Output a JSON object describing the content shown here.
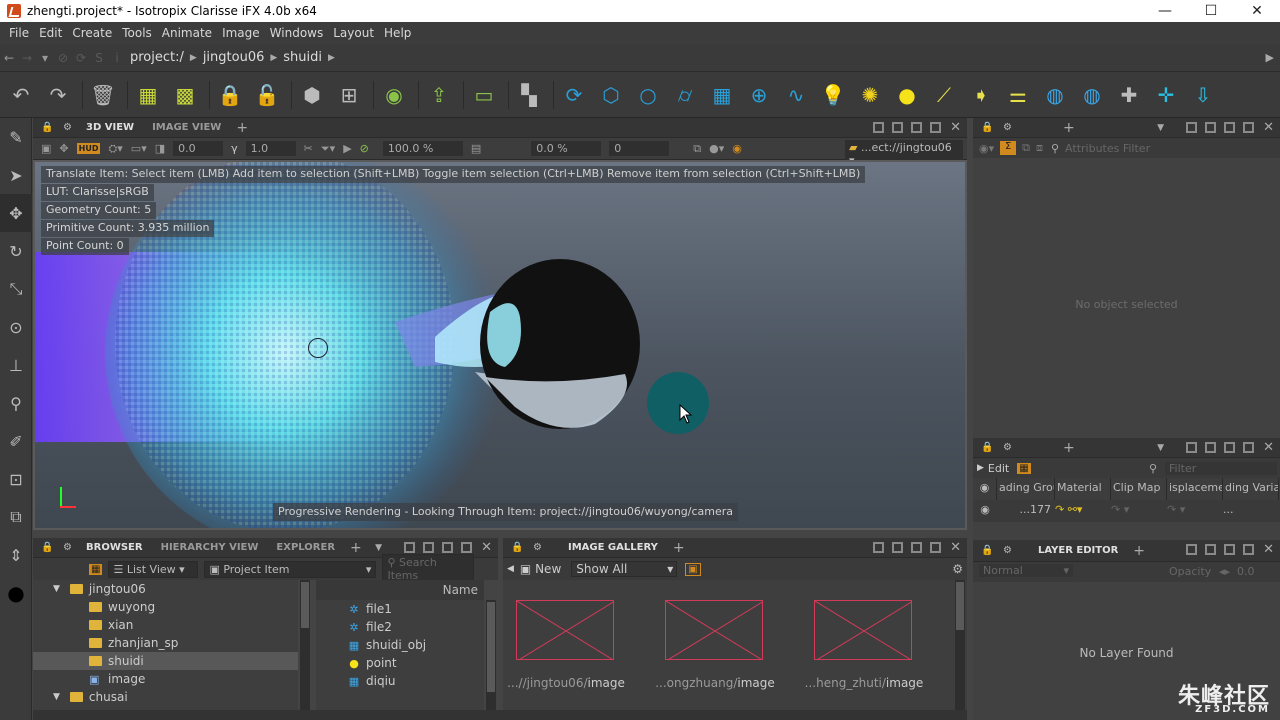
{
  "window": {
    "title": "zhengti.project* - Isotropix Clarisse iFX 4.0b x64"
  },
  "menu": [
    "File",
    "Edit",
    "Create",
    "Tools",
    "Animate",
    "Image",
    "Windows",
    "Layout",
    "Help"
  ],
  "pathbar": {
    "segments": [
      "project:/",
      "jingtou06",
      "shuidi"
    ]
  },
  "toolbar_icons": [
    "undo-icon",
    "redo-icon",
    "delete-icon",
    "group-icon",
    "ungroup-icon",
    "lock-icon",
    "unlock-icon",
    "box-icon",
    "scatter-icon",
    "reference-icon",
    "import-icon",
    "comment-icon",
    "context-icon",
    "rotate-icon",
    "cube-icon",
    "sphere-icon",
    "cylinder-icon",
    "grid-icon",
    "geosphere-icon",
    "curve-icon",
    "light-bulb-icon",
    "sun-icon",
    "point-light-icon",
    "spotlight-icon",
    "directional-light-icon",
    "area-light-icon",
    "sky-icon",
    "globe-icon",
    "transform-icon",
    "add-icon",
    "download-icon"
  ],
  "viewport": {
    "tabs": [
      "3D VIEW",
      "IMAGE VIEW"
    ],
    "toolbar": {
      "hud": "HUD",
      "exposure": "0.0",
      "gamma": "1.0",
      "zoom": "100.0 %",
      "offset": "0.0 %",
      "frame": "0",
      "path": "...ect://jingtou06"
    },
    "help": "Translate Item: Select item (LMB)  Add item to selection (Shift+LMB)  Toggle item selection (Ctrl+LMB)  Remove item from selection (Ctrl+Shift+LMB)",
    "lut": "LUT: Clarisse|sRGB",
    "geometry_count": "Geometry Count: 5",
    "primitive_count": "Primitive Count: 3.935 million",
    "point_count": "Point Count: 0",
    "status": "Progressive Rendering - Looking Through Item: project://jingtou06/wuyong/camera"
  },
  "attributes": {
    "filter_placeholder": "Attributes Filter",
    "empty": "No object selected"
  },
  "editor": {
    "edit_label": "Edit",
    "filter_placeholder": "Filter",
    "columns": [
      "ading Grou",
      "Material",
      "Clip Map",
      "isplaceme",
      "ding Varia"
    ],
    "row_value": "...177"
  },
  "layer_editor": {
    "title": "LAYER EDITOR",
    "blend": "Normal",
    "opacity_label": "Opacity",
    "opacity": "0.0",
    "empty": "No Layer Found"
  },
  "browser": {
    "tabs": [
      "BROWSER",
      "HIERARCHY VIEW",
      "EXPLORER"
    ],
    "view_mode": "List View",
    "item_type": "Project Item",
    "search_placeholder": "Search Items",
    "tree": [
      {
        "label": "jingtou06",
        "depth": 0,
        "expanded": true
      },
      {
        "label": "wuyong",
        "depth": 1
      },
      {
        "label": "xian",
        "depth": 1
      },
      {
        "label": "zhanjian_sp",
        "depth": 1
      },
      {
        "label": "shuidi",
        "depth": 1,
        "selected": true
      },
      {
        "label": "image",
        "depth": 1
      },
      {
        "label": "chusai",
        "depth": 0
      }
    ],
    "list_header": "Name",
    "list": [
      {
        "label": "file1",
        "icon": "particle-icon"
      },
      {
        "label": "file2",
        "icon": "particle-icon"
      },
      {
        "label": "shuidi_obj",
        "icon": "mesh-icon"
      },
      {
        "label": "point",
        "icon": "point-light-icon"
      },
      {
        "label": "diqiu",
        "icon": "mesh-icon"
      }
    ]
  },
  "image_gallery": {
    "title": "IMAGE GALLERY",
    "new_label": "New",
    "filter": "Show All",
    "images": [
      {
        "prefix": "...//jingtou06/",
        "name": "image"
      },
      {
        "prefix": "...ongzhuang/",
        "name": "image"
      },
      {
        "prefix": "...heng_zhuti/",
        "name": "image"
      }
    ]
  },
  "watermark": {
    "main": "朱峰社区",
    "sub": "ZF3D.COM"
  },
  "colors": {
    "accent": "#d08a1e",
    "teal": "#0f5f65",
    "folder": "#e0b33a",
    "thumb_border": "#d23a5a"
  }
}
